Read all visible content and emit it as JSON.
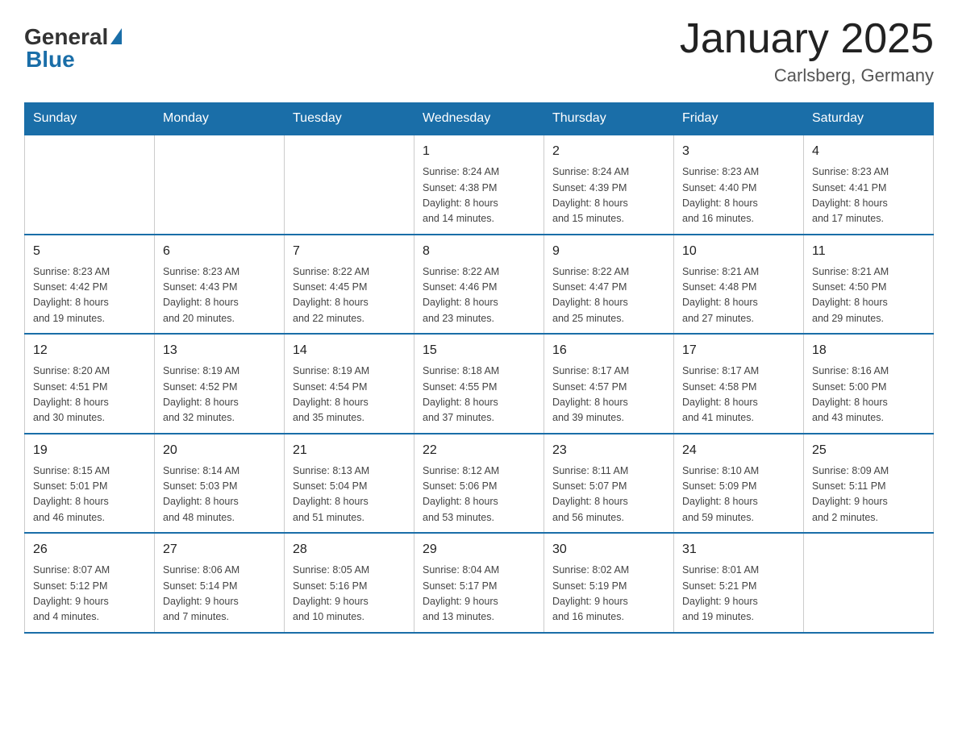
{
  "header": {
    "logo_general": "General",
    "logo_blue": "Blue",
    "title": "January 2025",
    "location": "Carlsberg, Germany"
  },
  "days_of_week": [
    "Sunday",
    "Monday",
    "Tuesday",
    "Wednesday",
    "Thursday",
    "Friday",
    "Saturday"
  ],
  "weeks": [
    [
      {
        "day": "",
        "info": ""
      },
      {
        "day": "",
        "info": ""
      },
      {
        "day": "",
        "info": ""
      },
      {
        "day": "1",
        "info": "Sunrise: 8:24 AM\nSunset: 4:38 PM\nDaylight: 8 hours\nand 14 minutes."
      },
      {
        "day": "2",
        "info": "Sunrise: 8:24 AM\nSunset: 4:39 PM\nDaylight: 8 hours\nand 15 minutes."
      },
      {
        "day": "3",
        "info": "Sunrise: 8:23 AM\nSunset: 4:40 PM\nDaylight: 8 hours\nand 16 minutes."
      },
      {
        "day": "4",
        "info": "Sunrise: 8:23 AM\nSunset: 4:41 PM\nDaylight: 8 hours\nand 17 minutes."
      }
    ],
    [
      {
        "day": "5",
        "info": "Sunrise: 8:23 AM\nSunset: 4:42 PM\nDaylight: 8 hours\nand 19 minutes."
      },
      {
        "day": "6",
        "info": "Sunrise: 8:23 AM\nSunset: 4:43 PM\nDaylight: 8 hours\nand 20 minutes."
      },
      {
        "day": "7",
        "info": "Sunrise: 8:22 AM\nSunset: 4:45 PM\nDaylight: 8 hours\nand 22 minutes."
      },
      {
        "day": "8",
        "info": "Sunrise: 8:22 AM\nSunset: 4:46 PM\nDaylight: 8 hours\nand 23 minutes."
      },
      {
        "day": "9",
        "info": "Sunrise: 8:22 AM\nSunset: 4:47 PM\nDaylight: 8 hours\nand 25 minutes."
      },
      {
        "day": "10",
        "info": "Sunrise: 8:21 AM\nSunset: 4:48 PM\nDaylight: 8 hours\nand 27 minutes."
      },
      {
        "day": "11",
        "info": "Sunrise: 8:21 AM\nSunset: 4:50 PM\nDaylight: 8 hours\nand 29 minutes."
      }
    ],
    [
      {
        "day": "12",
        "info": "Sunrise: 8:20 AM\nSunset: 4:51 PM\nDaylight: 8 hours\nand 30 minutes."
      },
      {
        "day": "13",
        "info": "Sunrise: 8:19 AM\nSunset: 4:52 PM\nDaylight: 8 hours\nand 32 minutes."
      },
      {
        "day": "14",
        "info": "Sunrise: 8:19 AM\nSunset: 4:54 PM\nDaylight: 8 hours\nand 35 minutes."
      },
      {
        "day": "15",
        "info": "Sunrise: 8:18 AM\nSunset: 4:55 PM\nDaylight: 8 hours\nand 37 minutes."
      },
      {
        "day": "16",
        "info": "Sunrise: 8:17 AM\nSunset: 4:57 PM\nDaylight: 8 hours\nand 39 minutes."
      },
      {
        "day": "17",
        "info": "Sunrise: 8:17 AM\nSunset: 4:58 PM\nDaylight: 8 hours\nand 41 minutes."
      },
      {
        "day": "18",
        "info": "Sunrise: 8:16 AM\nSunset: 5:00 PM\nDaylight: 8 hours\nand 43 minutes."
      }
    ],
    [
      {
        "day": "19",
        "info": "Sunrise: 8:15 AM\nSunset: 5:01 PM\nDaylight: 8 hours\nand 46 minutes."
      },
      {
        "day": "20",
        "info": "Sunrise: 8:14 AM\nSunset: 5:03 PM\nDaylight: 8 hours\nand 48 minutes."
      },
      {
        "day": "21",
        "info": "Sunrise: 8:13 AM\nSunset: 5:04 PM\nDaylight: 8 hours\nand 51 minutes."
      },
      {
        "day": "22",
        "info": "Sunrise: 8:12 AM\nSunset: 5:06 PM\nDaylight: 8 hours\nand 53 minutes."
      },
      {
        "day": "23",
        "info": "Sunrise: 8:11 AM\nSunset: 5:07 PM\nDaylight: 8 hours\nand 56 minutes."
      },
      {
        "day": "24",
        "info": "Sunrise: 8:10 AM\nSunset: 5:09 PM\nDaylight: 8 hours\nand 59 minutes."
      },
      {
        "day": "25",
        "info": "Sunrise: 8:09 AM\nSunset: 5:11 PM\nDaylight: 9 hours\nand 2 minutes."
      }
    ],
    [
      {
        "day": "26",
        "info": "Sunrise: 8:07 AM\nSunset: 5:12 PM\nDaylight: 9 hours\nand 4 minutes."
      },
      {
        "day": "27",
        "info": "Sunrise: 8:06 AM\nSunset: 5:14 PM\nDaylight: 9 hours\nand 7 minutes."
      },
      {
        "day": "28",
        "info": "Sunrise: 8:05 AM\nSunset: 5:16 PM\nDaylight: 9 hours\nand 10 minutes."
      },
      {
        "day": "29",
        "info": "Sunrise: 8:04 AM\nSunset: 5:17 PM\nDaylight: 9 hours\nand 13 minutes."
      },
      {
        "day": "30",
        "info": "Sunrise: 8:02 AM\nSunset: 5:19 PM\nDaylight: 9 hours\nand 16 minutes."
      },
      {
        "day": "31",
        "info": "Sunrise: 8:01 AM\nSunset: 5:21 PM\nDaylight: 9 hours\nand 19 minutes."
      },
      {
        "day": "",
        "info": ""
      }
    ]
  ]
}
